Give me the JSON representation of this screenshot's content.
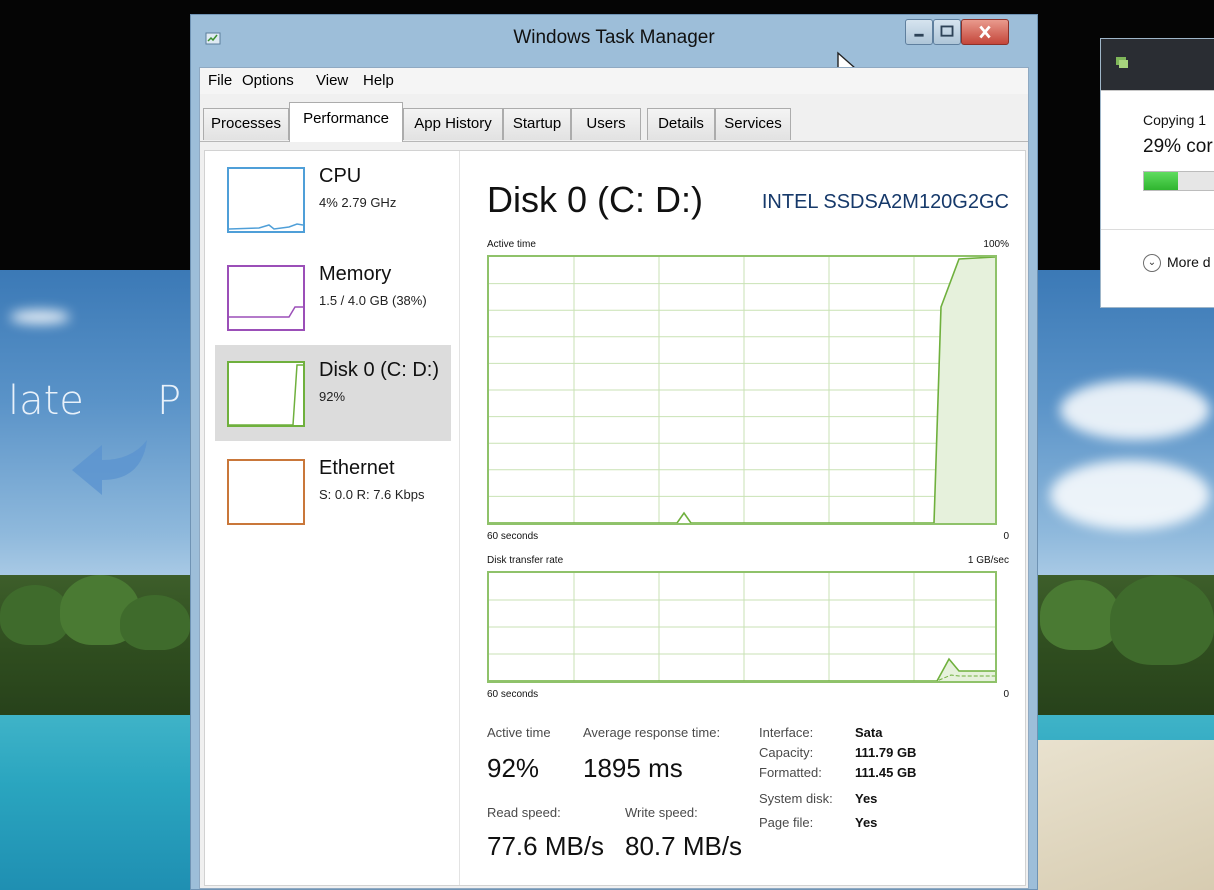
{
  "background": {
    "partial_text_left": "late",
    "partial_text_right": "P"
  },
  "copy_dialog": {
    "line1": "Copying 1",
    "line2": "29% cor",
    "progress_fraction": 0.29,
    "more_label": "More d"
  },
  "window": {
    "title": "Windows Task Manager",
    "menu": [
      "File",
      "Options",
      "View",
      "Help"
    ],
    "tabs": [
      "Processes",
      "Performance",
      "App History",
      "Startup",
      "Users",
      "Details",
      "Services"
    ],
    "active_tab": "Performance"
  },
  "sidebar": {
    "items": [
      {
        "name": "CPU",
        "sub": "4% 2.79 GHz",
        "color": "#4f9fd8"
      },
      {
        "name": "Memory",
        "sub": "1.5 / 4.0 GB (38%)",
        "color": "#9b4fb8"
      },
      {
        "name": "Disk 0 (C: D:)",
        "sub": "92%",
        "color": "#6fb03d"
      },
      {
        "name": "Ethernet",
        "sub": "S: 0.0 R: 7.6 Kbps",
        "color": "#c9773a"
      }
    ],
    "selected": "Disk 0 (C: D:)"
  },
  "detail": {
    "title": "Disk 0 (C: D:)",
    "model": "INTEL SSDSA2M120G2GC",
    "active_graph": {
      "label": "Active time",
      "max_label": "100%",
      "time_label": "60 seconds",
      "min_label": "0"
    },
    "transfer_graph": {
      "label": "Disk transfer rate",
      "max_label": "1 GB/sec",
      "time_label": "60 seconds",
      "min_label": "0"
    },
    "stats": {
      "active_time_label": "Active time",
      "active_time_value": "92%",
      "response_label": "Average response time:",
      "response_value": "1895 ms",
      "read_label": "Read speed:",
      "read_value": "77.6 MB/s",
      "write_label": "Write speed:",
      "write_value": "80.7 MB/s"
    },
    "properties": [
      {
        "label": "Interface:",
        "value": "Sata"
      },
      {
        "label": "Capacity:",
        "value": "111.79 GB"
      },
      {
        "label": "Formatted:",
        "value": "111.45 GB"
      },
      {
        "label": "System disk:",
        "value": "Yes"
      },
      {
        "label": "Page file:",
        "value": "Yes"
      }
    ]
  },
  "colors": {
    "graph_green": "#8fc26a",
    "window_frame": "#9dbed9",
    "close_red": "#c4463a"
  }
}
